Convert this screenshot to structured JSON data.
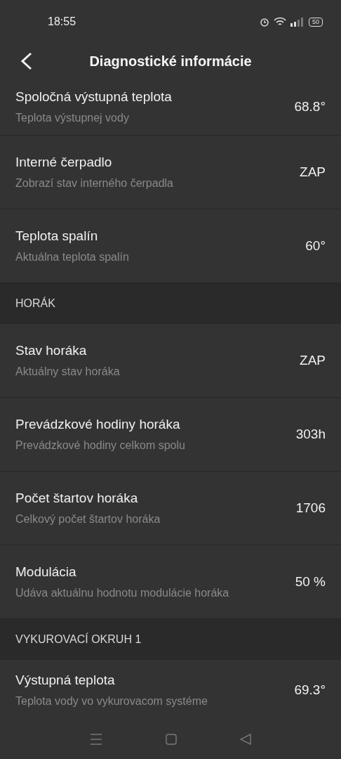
{
  "status_bar": {
    "time": "18:55",
    "battery": "50"
  },
  "header": {
    "title": "Diagnostické informácie"
  },
  "sections": [
    {
      "rows": [
        {
          "title": "Spoločná výstupná teplota",
          "subtitle": "Teplota výstupnej vody",
          "value": "68.8°"
        },
        {
          "title": "Interné čerpadlo",
          "subtitle": "Zobrazí stav interného čerpadla",
          "value": "ZAP"
        },
        {
          "title": "Teplota spalín",
          "subtitle": "Aktuálna teplota spalín",
          "value": "60°"
        }
      ]
    },
    {
      "heading": "HORÁK",
      "rows": [
        {
          "title": "Stav horáka",
          "subtitle": "Aktuálny stav horáka",
          "value": "ZAP"
        },
        {
          "title": "Prevádzkové hodiny horáka",
          "subtitle": "Prevádzkové hodiny celkom spolu",
          "value": "303h"
        },
        {
          "title": "Počet štartov horáka",
          "subtitle": "Celkový počet štartov horáka",
          "value": "1706"
        },
        {
          "title": "Modulácia",
          "subtitle": "Udáva aktuálnu hodnotu modulácie horáka",
          "value": "50 %"
        }
      ]
    },
    {
      "heading": "VYKUROVACÍ OKRUH 1",
      "rows": [
        {
          "title": "Výstupná teplota",
          "subtitle": "Teplota vody vo vykurovacom systéme",
          "value": "69.3°"
        }
      ]
    }
  ]
}
